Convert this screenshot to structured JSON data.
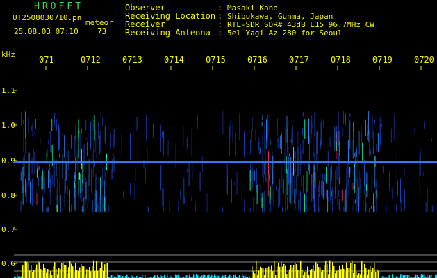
{
  "header": {
    "logo": "HROFFT",
    "filename": "UT2508030710.pn",
    "meteor_label": "meteor",
    "datetime": "25.08.03 07:10",
    "count": "73"
  },
  "metadata": [
    {
      "label": "Observer",
      "value": "Masaki Kano"
    },
    {
      "label": "Receiving Location",
      "value": "Shibukawa, Gunma, Japan"
    },
    {
      "label": "Receiver",
      "value": "RTL-SDR SDR# 43dB L15 96.7MHz CW"
    },
    {
      "label": "Receiving Antenna",
      "value": "5el Yagi Az 280 for Seoul"
    }
  ],
  "colon": ":",
  "axis": {
    "unit": "kHz",
    "time_ticks": [
      "071",
      "0712",
      "0713",
      "0714",
      "0715",
      "0716",
      "0717",
      "0718",
      "0719",
      "0720"
    ],
    "freq_ticks": [
      "1.1",
      "1.0",
      "0.9",
      "0.8",
      "0.7",
      "0.6"
    ]
  },
  "colors": {
    "background": "#000000",
    "text": "#f2f200",
    "logo": "#33e04a",
    "signal_line": "#2a7cff",
    "meteor_hot": "#ff2f6d",
    "meteor_warm": "#19ff9c",
    "count_bar": "#ffff00",
    "count_base": "#00e6ff"
  }
}
